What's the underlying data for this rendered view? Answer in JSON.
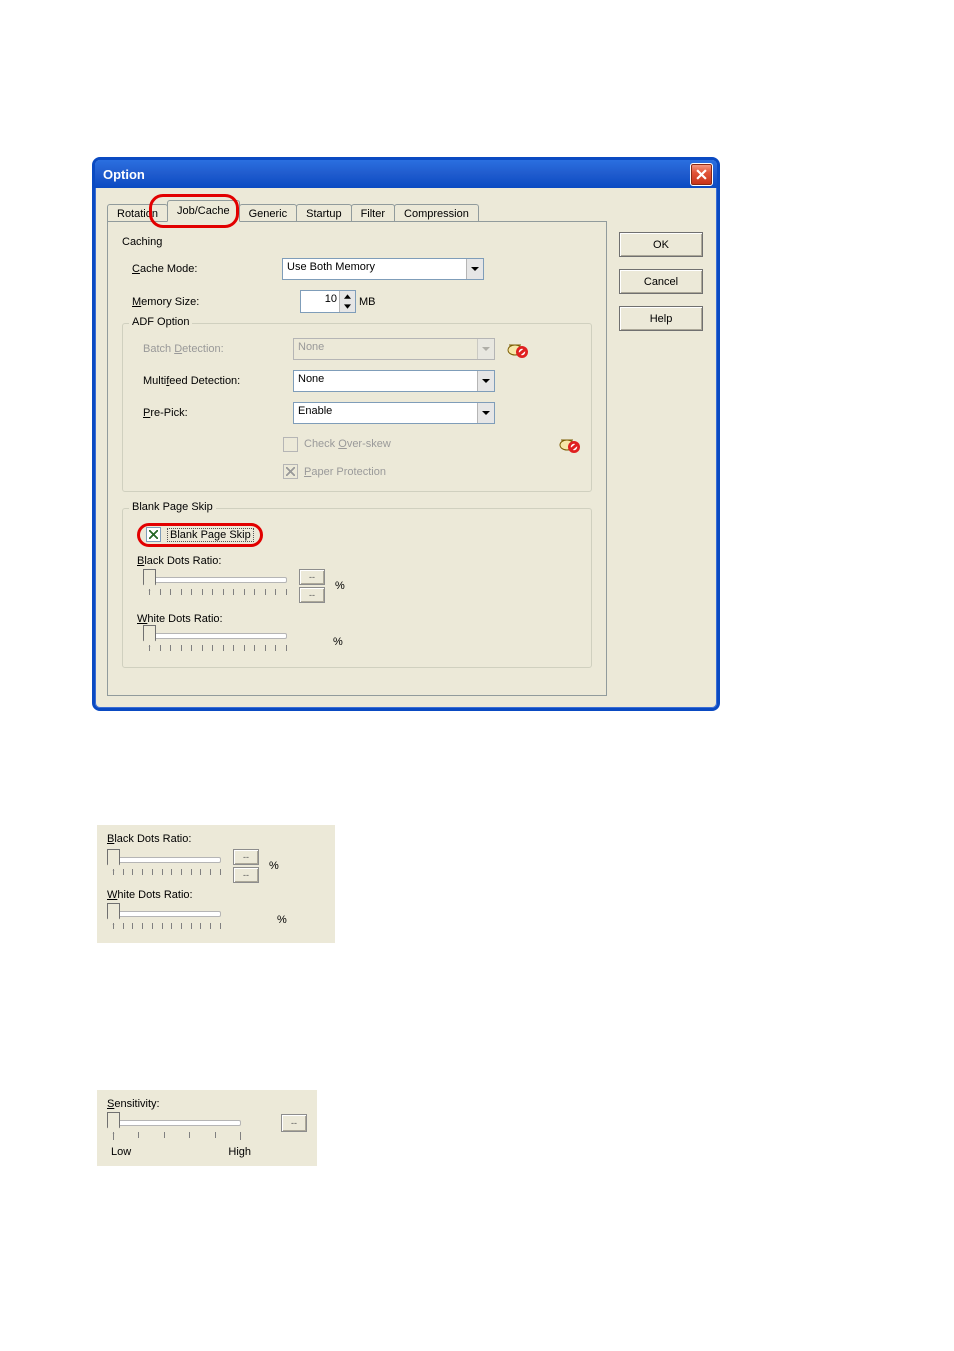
{
  "dialog": {
    "title": "Option",
    "tabs": [
      "Rotation",
      "Job/Cache",
      "Generic",
      "Startup",
      "Filter",
      "Compression"
    ],
    "active_tab_index": 1,
    "buttons": {
      "ok": "OK",
      "cancel": "Cancel",
      "help": "Help"
    },
    "caching": {
      "legend": "Caching",
      "cache_mode_label_pre": "C",
      "cache_mode_label_post": "ache Mode:",
      "cache_mode_value": "Use Both Memory",
      "memory_size_label_pre": "M",
      "memory_size_label_post": "emory Size:",
      "memory_size_value": "10",
      "memory_size_suffix": "MB"
    },
    "adf": {
      "legend": "ADF Option",
      "batch_label_pre": "Batch ",
      "batch_label_u": "D",
      "batch_label_post": "etection:",
      "batch_value": "None",
      "multifeed_label_pre": "Multi",
      "multifeed_label_u": "f",
      "multifeed_label_post": "eed Detection:",
      "multifeed_value": "None",
      "prepick_label_pre": "P",
      "prepick_label_post": "re-Pick:",
      "prepick_value": "Enable",
      "check_overskew_label_pre": "Check ",
      "check_overskew_label_u": "O",
      "check_overskew_label_post": "ver-skew",
      "paper_protection_label_pre": "P",
      "paper_protection_label_post": "aper Protection"
    },
    "blankskip": {
      "legend": "Blank Page Skip",
      "checkbox_label": "Blank Page Skip",
      "black_label_pre": "B",
      "black_label_post": "lack Dots Ratio:",
      "black_step_val": "--",
      "white_label_pre": "W",
      "white_label_post": "hite Dots Ratio:",
      "pct": "%"
    }
  },
  "snippet1": {
    "black_label_pre": "B",
    "black_label_post": "lack Dots Ratio:",
    "white_label_pre": "W",
    "white_label_post": "hite Dots Ratio:",
    "step_val": "--",
    "pct": "%"
  },
  "snippet2": {
    "sens_label_pre": "S",
    "sens_label_post": "ensitivity:",
    "low": "Low",
    "high": "High",
    "val": "--"
  }
}
